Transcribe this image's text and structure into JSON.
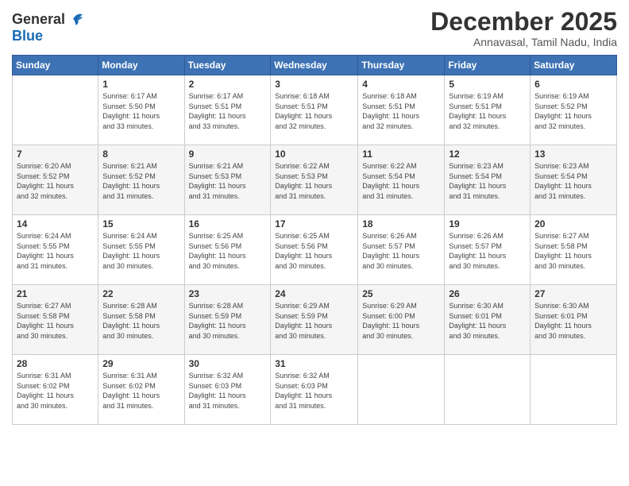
{
  "header": {
    "logo_line1": "General",
    "logo_line2": "Blue",
    "month_title": "December 2025",
    "location": "Annavasal, Tamil Nadu, India"
  },
  "days_of_week": [
    "Sunday",
    "Monday",
    "Tuesday",
    "Wednesday",
    "Thursday",
    "Friday",
    "Saturday"
  ],
  "weeks": [
    [
      {
        "day": "",
        "info": ""
      },
      {
        "day": "1",
        "info": "Sunrise: 6:17 AM\nSunset: 5:50 PM\nDaylight: 11 hours\nand 33 minutes."
      },
      {
        "day": "2",
        "info": "Sunrise: 6:17 AM\nSunset: 5:51 PM\nDaylight: 11 hours\nand 33 minutes."
      },
      {
        "day": "3",
        "info": "Sunrise: 6:18 AM\nSunset: 5:51 PM\nDaylight: 11 hours\nand 32 minutes."
      },
      {
        "day": "4",
        "info": "Sunrise: 6:18 AM\nSunset: 5:51 PM\nDaylight: 11 hours\nand 32 minutes."
      },
      {
        "day": "5",
        "info": "Sunrise: 6:19 AM\nSunset: 5:51 PM\nDaylight: 11 hours\nand 32 minutes."
      },
      {
        "day": "6",
        "info": "Sunrise: 6:19 AM\nSunset: 5:52 PM\nDaylight: 11 hours\nand 32 minutes."
      }
    ],
    [
      {
        "day": "7",
        "info": "Sunrise: 6:20 AM\nSunset: 5:52 PM\nDaylight: 11 hours\nand 32 minutes."
      },
      {
        "day": "8",
        "info": "Sunrise: 6:21 AM\nSunset: 5:52 PM\nDaylight: 11 hours\nand 31 minutes."
      },
      {
        "day": "9",
        "info": "Sunrise: 6:21 AM\nSunset: 5:53 PM\nDaylight: 11 hours\nand 31 minutes."
      },
      {
        "day": "10",
        "info": "Sunrise: 6:22 AM\nSunset: 5:53 PM\nDaylight: 11 hours\nand 31 minutes."
      },
      {
        "day": "11",
        "info": "Sunrise: 6:22 AM\nSunset: 5:54 PM\nDaylight: 11 hours\nand 31 minutes."
      },
      {
        "day": "12",
        "info": "Sunrise: 6:23 AM\nSunset: 5:54 PM\nDaylight: 11 hours\nand 31 minutes."
      },
      {
        "day": "13",
        "info": "Sunrise: 6:23 AM\nSunset: 5:54 PM\nDaylight: 11 hours\nand 31 minutes."
      }
    ],
    [
      {
        "day": "14",
        "info": "Sunrise: 6:24 AM\nSunset: 5:55 PM\nDaylight: 11 hours\nand 31 minutes."
      },
      {
        "day": "15",
        "info": "Sunrise: 6:24 AM\nSunset: 5:55 PM\nDaylight: 11 hours\nand 30 minutes."
      },
      {
        "day": "16",
        "info": "Sunrise: 6:25 AM\nSunset: 5:56 PM\nDaylight: 11 hours\nand 30 minutes."
      },
      {
        "day": "17",
        "info": "Sunrise: 6:25 AM\nSunset: 5:56 PM\nDaylight: 11 hours\nand 30 minutes."
      },
      {
        "day": "18",
        "info": "Sunrise: 6:26 AM\nSunset: 5:57 PM\nDaylight: 11 hours\nand 30 minutes."
      },
      {
        "day": "19",
        "info": "Sunrise: 6:26 AM\nSunset: 5:57 PM\nDaylight: 11 hours\nand 30 minutes."
      },
      {
        "day": "20",
        "info": "Sunrise: 6:27 AM\nSunset: 5:58 PM\nDaylight: 11 hours\nand 30 minutes."
      }
    ],
    [
      {
        "day": "21",
        "info": "Sunrise: 6:27 AM\nSunset: 5:58 PM\nDaylight: 11 hours\nand 30 minutes."
      },
      {
        "day": "22",
        "info": "Sunrise: 6:28 AM\nSunset: 5:58 PM\nDaylight: 11 hours\nand 30 minutes."
      },
      {
        "day": "23",
        "info": "Sunrise: 6:28 AM\nSunset: 5:59 PM\nDaylight: 11 hours\nand 30 minutes."
      },
      {
        "day": "24",
        "info": "Sunrise: 6:29 AM\nSunset: 5:59 PM\nDaylight: 11 hours\nand 30 minutes."
      },
      {
        "day": "25",
        "info": "Sunrise: 6:29 AM\nSunset: 6:00 PM\nDaylight: 11 hours\nand 30 minutes."
      },
      {
        "day": "26",
        "info": "Sunrise: 6:30 AM\nSunset: 6:01 PM\nDaylight: 11 hours\nand 30 minutes."
      },
      {
        "day": "27",
        "info": "Sunrise: 6:30 AM\nSunset: 6:01 PM\nDaylight: 11 hours\nand 30 minutes."
      }
    ],
    [
      {
        "day": "28",
        "info": "Sunrise: 6:31 AM\nSunset: 6:02 PM\nDaylight: 11 hours\nand 30 minutes."
      },
      {
        "day": "29",
        "info": "Sunrise: 6:31 AM\nSunset: 6:02 PM\nDaylight: 11 hours\nand 31 minutes."
      },
      {
        "day": "30",
        "info": "Sunrise: 6:32 AM\nSunset: 6:03 PM\nDaylight: 11 hours\nand 31 minutes."
      },
      {
        "day": "31",
        "info": "Sunrise: 6:32 AM\nSunset: 6:03 PM\nDaylight: 11 hours\nand 31 minutes."
      },
      {
        "day": "",
        "info": ""
      },
      {
        "day": "",
        "info": ""
      },
      {
        "day": "",
        "info": ""
      }
    ]
  ]
}
